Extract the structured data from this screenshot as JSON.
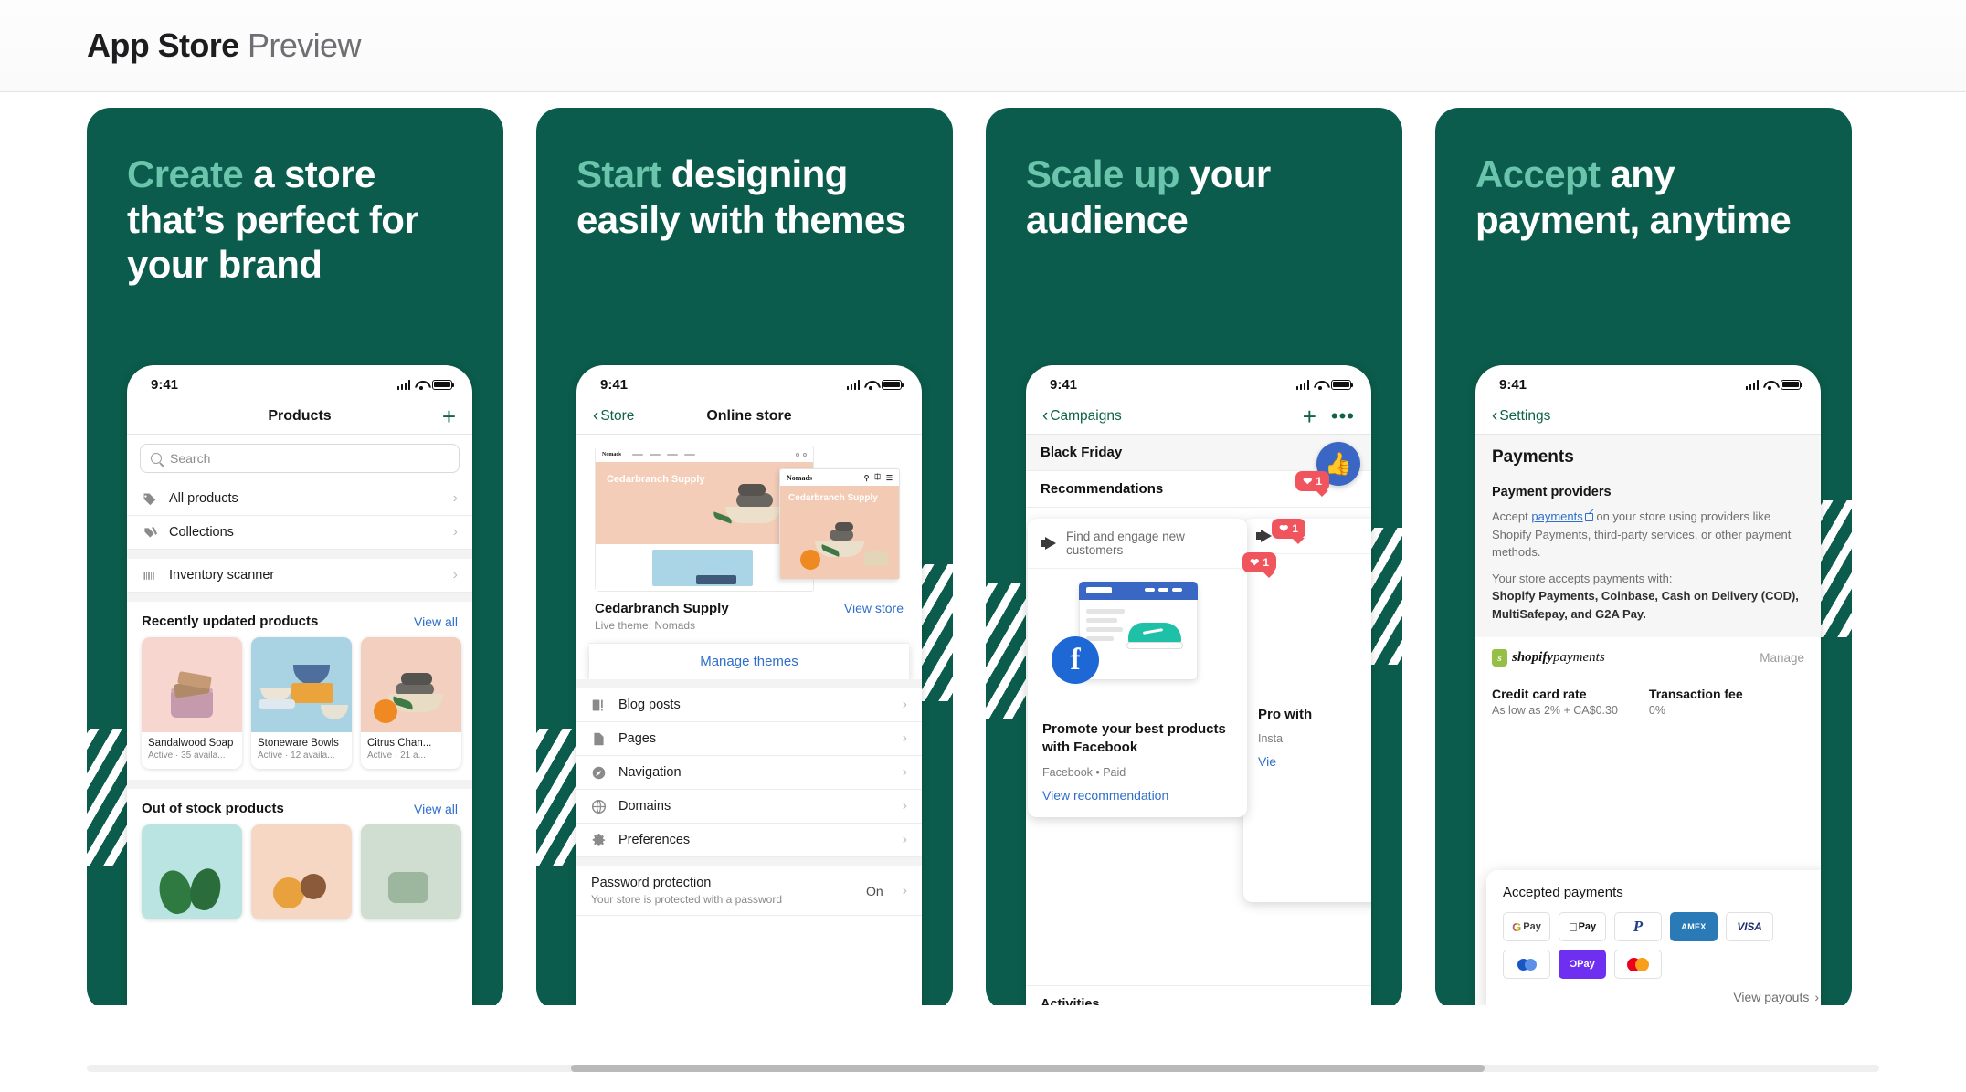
{
  "header": {
    "title_bold": "App Store",
    "title_light": "Preview"
  },
  "panels": [
    {
      "headline_accent": "Create",
      "headline_rest": " a store that’s perfect for your brand",
      "phone": {
        "time": "9:41",
        "nav_title": "Products",
        "nav_plus": "+",
        "search_placeholder": "Search",
        "menu": [
          {
            "label": "All products",
            "icon": "tag-icon"
          },
          {
            "label": "Collections",
            "icon": "collections-icon"
          },
          {
            "label": "Inventory scanner",
            "icon": "barcode-icon"
          }
        ],
        "recent_title": "Recently updated products",
        "recent_link": "View all",
        "recent_products": [
          {
            "name": "Sandalwood Soap",
            "status": "Active · 35 availa..."
          },
          {
            "name": "Stoneware Bowls",
            "status": "Active · 12 availa..."
          },
          {
            "name": "Citrus Chan...",
            "status": "Active · 21 a..."
          }
        ],
        "oos_title": "Out of stock products",
        "oos_link": "View all"
      }
    },
    {
      "headline_accent": "Start",
      "headline_rest": " designing easily with themes",
      "phone": {
        "time": "9:41",
        "back_label": "Store",
        "nav_title": "Online store",
        "theme_brand_desktop": "Nomads",
        "theme_hero_desktop": "Cedarbranch Supply",
        "theme_brand_mobile": "Nomads",
        "theme_hero_mobile": "Cedarbranch Supply",
        "store_name": "Cedarbranch Supply",
        "store_sub": "Live theme: Nomads",
        "view_store_link": "View store",
        "manage_themes": "Manage themes",
        "menu": [
          {
            "label": "Blog posts",
            "icon": "blog-icon"
          },
          {
            "label": "Pages",
            "icon": "page-icon"
          },
          {
            "label": "Navigation",
            "icon": "compass-icon"
          },
          {
            "label": "Domains",
            "icon": "globe-icon"
          },
          {
            "label": "Preferences",
            "icon": "gear-icon"
          }
        ],
        "password_title": "Password protection",
        "password_sub": "Your store is protected with a password",
        "password_value": "On"
      }
    },
    {
      "headline_accent": "Scale up",
      "headline_rest": " your audience",
      "phone": {
        "time": "9:41",
        "back_label": "Campaigns",
        "nav_plus": "+",
        "nav_more": "•••",
        "rows": [
          "Black Friday",
          "Recommendations"
        ],
        "reco_head": "Find and engage new customers",
        "reco_title": "Promote your best products with Facebook",
        "reco_sub": "Facebook • Paid",
        "reco_link": "View recommendation",
        "reco2_title": "Pro with",
        "reco2_sub": "Insta",
        "reco2_link": "Vie",
        "activities": "Activities",
        "badges": [
          "1",
          "1",
          "1"
        ]
      }
    },
    {
      "headline_accent": "Accept",
      "headline_rest": " any payment, anytime",
      "phone": {
        "time": "9:41",
        "back_label": "Settings",
        "page_title": "Payments",
        "section_title": "Payment providers",
        "body_pre": "Accept ",
        "body_link": "payments",
        "body_post": " on your store using providers like Shopify Payments, third-party services, or other payment methods.",
        "accepts_intro": "Your store accepts payments with:",
        "accepts_list": "Shopify Payments, Coinbase, Cash on Delivery (COD), MultiSafepay, and G2A Pay.",
        "sp_logo_bold": "shopify",
        "sp_logo_light": "payments",
        "sp_manage": "Manage",
        "rates": [
          {
            "label": "Credit card rate",
            "value": "As low as 2% + CA$0.30"
          },
          {
            "label": "Transaction fee",
            "value": "0%"
          }
        ],
        "accepted_title": "Accepted payments",
        "methods": [
          "google-pay",
          "apple-pay",
          "paypal",
          "amex",
          "visa",
          "diners-club",
          "opay",
          "mastercard"
        ],
        "method_labels": {
          "google_pay": "Pay",
          "google_g": "G",
          "apple_pay": "Pay",
          "apple_mark": "",
          "paypal": "P",
          "amex": "AMEX",
          "visa": "VISA",
          "opay": "ƆPay"
        },
        "view_payouts": "View payouts"
      }
    }
  ],
  "colors": {
    "brand_green": "#0b5c4c",
    "accent_mint": "#6bc4ac",
    "link_blue": "#2f6ecb",
    "shopify_green": "#0e6245",
    "badge_red": "#f0555e"
  }
}
